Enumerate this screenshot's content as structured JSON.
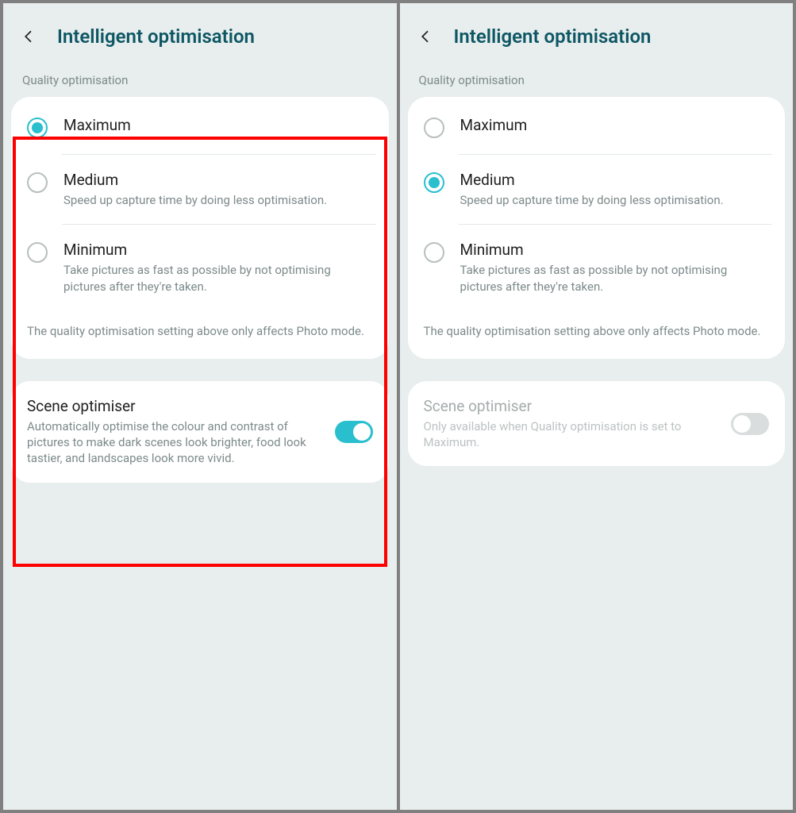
{
  "screens": [
    {
      "title": "Intelligent optimisation",
      "section_label": "Quality optimisation",
      "options": [
        {
          "label": "Maximum",
          "desc": "",
          "selected": true
        },
        {
          "label": "Medium",
          "desc": "Speed up capture time by doing less optimisation.",
          "selected": false
        },
        {
          "label": "Minimum",
          "desc": "Take pictures as fast as possible by not optimising pictures after they're taken.",
          "selected": false
        }
      ],
      "note": "The quality optimisation setting above only affects Photo mode.",
      "scene": {
        "title": "Scene optimiser",
        "desc": "Automatically optimise the colour and contrast of pictures to make dark scenes look brighter, food look tastier, and landscapes look more vivid.",
        "enabled": true,
        "disabled_look": false
      },
      "highlight": true
    },
    {
      "title": "Intelligent optimisation",
      "section_label": "Quality optimisation",
      "options": [
        {
          "label": "Maximum",
          "desc": "",
          "selected": false
        },
        {
          "label": "Medium",
          "desc": "Speed up capture time by doing less optimisation.",
          "selected": true
        },
        {
          "label": "Minimum",
          "desc": "Take pictures as fast as possible by not optimising pictures after they're taken.",
          "selected": false
        }
      ],
      "note": "The quality optimisation setting above only affects Photo mode.",
      "scene": {
        "title": "Scene optimiser",
        "desc": "Only available when Quality optimisation is set to Maximum.",
        "enabled": false,
        "disabled_look": true
      },
      "highlight": false
    }
  ]
}
